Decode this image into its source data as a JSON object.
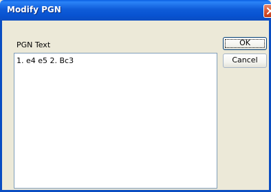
{
  "dialog": {
    "title": "Modify PGN",
    "pgn_label": "PGN Text",
    "pgn_value": "1. e4 e5 2. Bc3",
    "ok_label": "OK",
    "cancel_label": "Cancel",
    "close_icon": "close-icon"
  },
  "colors": {
    "titlebar": "#0A5FE3",
    "close_button": "#D85634",
    "dialog_background": "#ECE9D8",
    "textarea_border": "#7F9DB9"
  }
}
